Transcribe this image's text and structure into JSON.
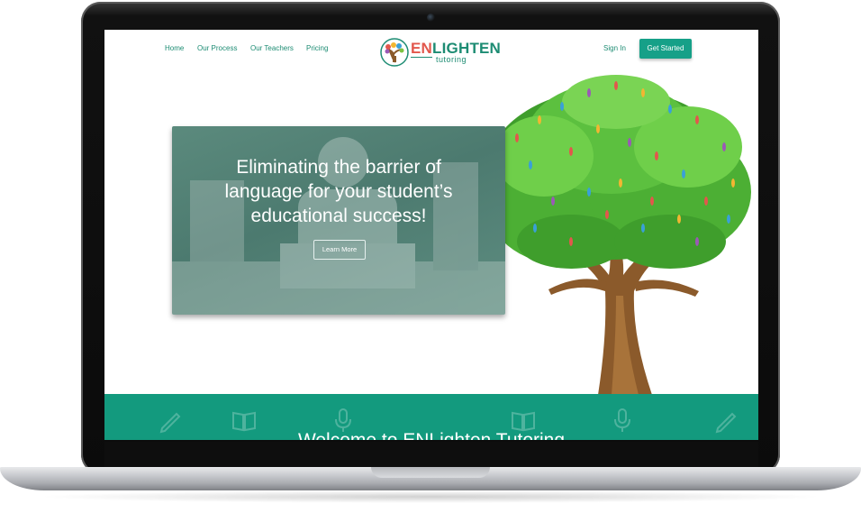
{
  "nav": {
    "links": [
      "Home",
      "Our Process",
      "Our Teachers",
      "Pricing"
    ],
    "sign_in": "Sign In",
    "get_started": "Get Started"
  },
  "logo": {
    "name_highlight": "EN",
    "name_rest": "LIGHTEN",
    "subtitle": "tutoring"
  },
  "hero": {
    "title_lines": [
      "Eliminating the barrier of",
      "language for your student’s",
      "educational success!"
    ],
    "button": "Learn More"
  },
  "band": {
    "title": "Welcome to ENLighten Tutoring",
    "icons": [
      "pencil-icon",
      "book-icon",
      "microphone-icon",
      "book-icon",
      "microphone-icon",
      "pencil-icon"
    ]
  },
  "colors": {
    "brand_green": "#1d8c73",
    "accent_red": "#e2574c",
    "band_teal": "#139a7e",
    "button_teal": "#16a088"
  }
}
